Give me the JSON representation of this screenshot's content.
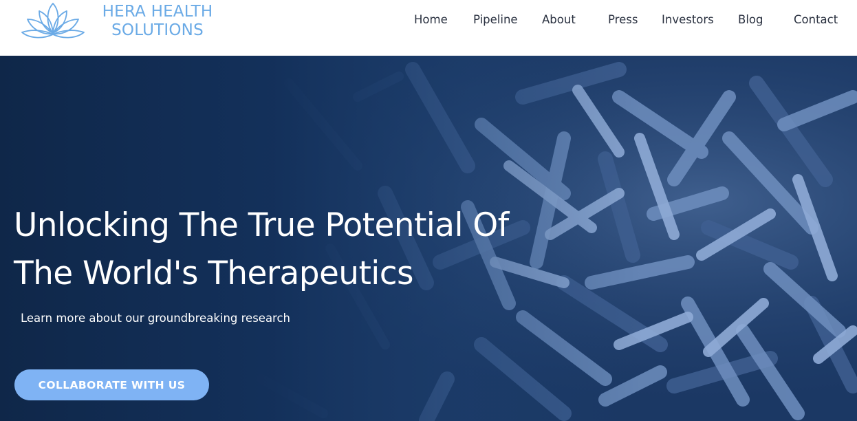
{
  "brand": {
    "name_line1": "HERA HEALTH",
    "name_line2": "SOLUTIONS",
    "logo_icon": "lotus-icon",
    "color": "#6aaae6"
  },
  "nav": {
    "items": [
      {
        "label": "Home"
      },
      {
        "label": "Pipeline"
      },
      {
        "label": "About"
      },
      {
        "label": "Press"
      },
      {
        "label": "Investors"
      },
      {
        "label": "Blog"
      },
      {
        "label": "Contact"
      }
    ]
  },
  "hero": {
    "headline_line1": "Unlocking The True Potential Of",
    "headline_line2": "The World's Therapeutics",
    "subheadline": "Learn more about our groundbreaking research",
    "cta_label": "COLLABORATE WITH US",
    "background_image": "bacteria-microscopy-image",
    "colors": {
      "overlay": "#10284d",
      "cta_background": "#7fb3f4",
      "text": "#ffffff"
    }
  }
}
